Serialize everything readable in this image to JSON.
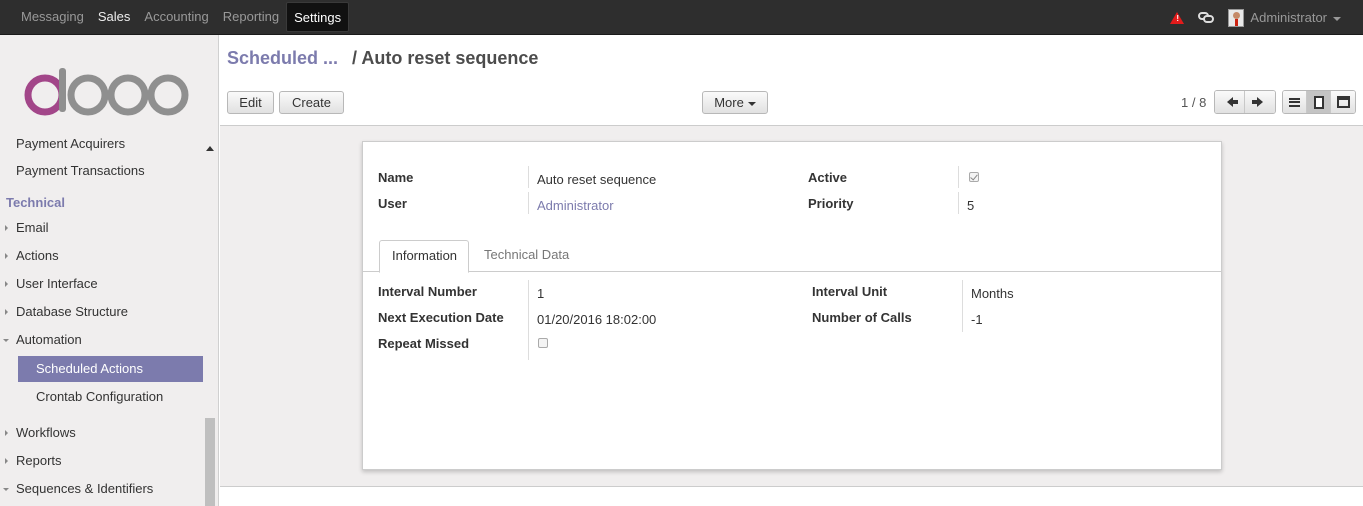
{
  "topbar": {
    "menu": [
      {
        "label": "Messaging"
      },
      {
        "label": "Sales"
      },
      {
        "label": "Accounting"
      },
      {
        "label": "Reporting"
      },
      {
        "label": "Settings"
      }
    ],
    "user": "Administrator",
    "colors": {
      "bar": "#2e2e2e",
      "alert": "#e21b1b"
    }
  },
  "sidebar": {
    "items": {
      "payment_acquirers": "Payment Acquirers",
      "payment_transactions": "Payment Transactions",
      "technical": "Technical",
      "email": "Email",
      "actions": "Actions",
      "user_interface": "User Interface",
      "database_structure": "Database Structure",
      "automation": "Automation",
      "scheduled_actions": "Scheduled Actions",
      "crontab_configuration": "Crontab Configuration",
      "workflows": "Workflows",
      "reports": "Reports",
      "sequences_identifiers": "Sequences & Identifiers"
    },
    "accent": "#7c7bad"
  },
  "control": {
    "breadcrumb_parent": "Scheduled ...",
    "breadcrumb_sep": "/",
    "breadcrumb_current": "Auto reset sequence",
    "edit_label": "Edit",
    "create_label": "Create",
    "more_label": "More",
    "pager": "1 / 8"
  },
  "form": {
    "name_label": "Name",
    "name_value": "Auto reset sequence",
    "user_label": "User",
    "user_value": "Administrator",
    "active_label": "Active",
    "active_checked": true,
    "priority_label": "Priority",
    "priority_value": "5",
    "tabs": {
      "information": "Information",
      "technical_data": "Technical Data"
    },
    "interval_number_label": "Interval Number",
    "interval_number_value": "1",
    "next_execution_label": "Next Execution Date",
    "next_execution_value": "01/20/2016 18:02:00",
    "repeat_missed_label": "Repeat Missed",
    "repeat_missed_checked": false,
    "interval_unit_label": "Interval Unit",
    "interval_unit_value": "Months",
    "number_of_calls_label": "Number of Calls",
    "number_of_calls_value": "-1"
  }
}
